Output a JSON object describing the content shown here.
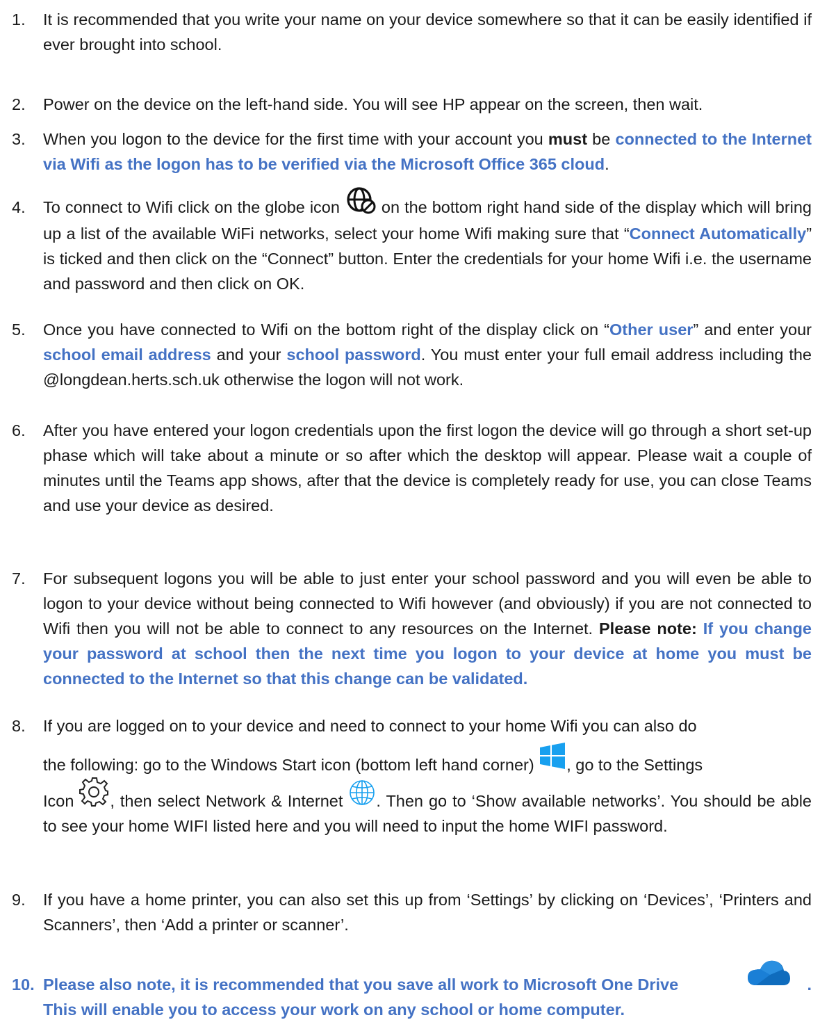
{
  "items": [
    {
      "num": "1.",
      "text": "It is recommended that you write your name on your device somewhere so that it can be easily identified if ever brought into school."
    },
    {
      "num": "2.",
      "text": "Power on the device on the left-hand side.  You will see HP appear on the screen, then wait."
    },
    {
      "num": "3.",
      "a": "When you logon to the device for the first time with your account you ",
      "must": "must",
      "b": " be ",
      "blue": "connected to the Internet via Wifi as the logon has to be verified via the Microsoft Office 365 cloud",
      "c": "."
    },
    {
      "num": "4.",
      "a": "To connect to Wifi click on the globe icon ",
      "b": " on the bottom right hand side of the display which will bring up a list of the available WiFi networks, select your home Wifi making sure that “",
      "blue": "Connect Automatically",
      "c": "” is ticked and then click on the “Connect” button. Enter the credentials for your home Wifi i.e. the username and password and then click on OK."
    },
    {
      "num": "5.",
      "a": "Once you have connected to Wifi on the bottom right of the display click on “",
      "blue1": "Other user",
      "b": "” and enter your ",
      "blue2": "school email address",
      "c": " and your ",
      "blue3": "school password",
      "d": ". You must enter your full email address including the @longdean.herts.sch.uk otherwise the logon will not work."
    },
    {
      "num": "6.",
      "text": "After you have entered your logon credentials upon the first logon the device will go through a short set-up phase which will take about a minute or so after which the desktop will appear. Please wait a couple of minutes until the Teams app shows, after that the device is completely ready for use, you can close Teams and use your device as desired."
    },
    {
      "num": "7.",
      "a": "For subsequent logons you will be able to just enter your school password and you will even be able to logon to your device without being connected to Wifi however (and obviously) if you are not connected to Wifi then you will not be able to connect to any resources on the Internet. ",
      "note": "Please note:",
      "blue": " If you change your password at school then the next time you logon to your device at home you must be connected to the Internet so that this change can be validated."
    },
    {
      "num": "8.",
      "a": "If you are logged on to your device and need to connect to your home Wifi you can also do",
      "b": "the following: go to the Windows Start icon (bottom left hand corner) ",
      "c": ", go to the Settings",
      "d": "Icon ",
      "e": ", then select Network & Internet ",
      "f": ".  Then go to ‘Show available networks’.  You should be able to see your home WIFI listed here and you will need to input the home WIFI password."
    },
    {
      "num": "9.",
      "text": "If you have a home printer, you can also set this up from ‘Settings’ by clicking on ‘Devices’, ‘Printers and Scanners’, then ‘Add a printer or scanner’."
    },
    {
      "num": "10.",
      "a": "Please also note, it is recommended that you save all work to Microsoft One Drive ",
      "b": ".",
      "c": "This will enable you to access your work on any school or home computer."
    }
  ],
  "colors": {
    "accent": "#4472c4",
    "text": "#1a1a1a"
  },
  "icons": [
    "globe-wifi-icon",
    "windows-start-icon",
    "settings-gear-icon",
    "network-globe-icon",
    "onedrive-cloud-icon"
  ]
}
